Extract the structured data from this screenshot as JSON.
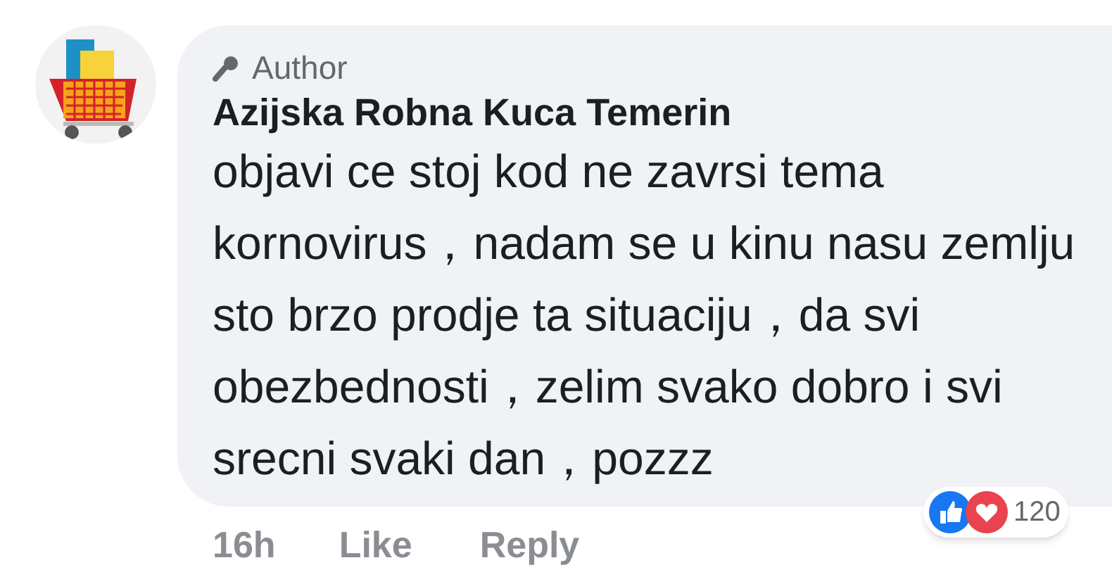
{
  "comment": {
    "badge": "Author",
    "author": "Azijska Robna Kuca Temerin",
    "text": "objavi ce stoj kod ne zavrsi tema kornovirus，nadam se u kinu nasu zemlju sto brzo prodje ta situaciju，da svi obezbednosti，zelim svako dobro i svi srecni svaki dan，pozzz",
    "time": "16h",
    "actions": [
      "Like",
      "Reply"
    ],
    "reactions": {
      "count": "120"
    }
  }
}
